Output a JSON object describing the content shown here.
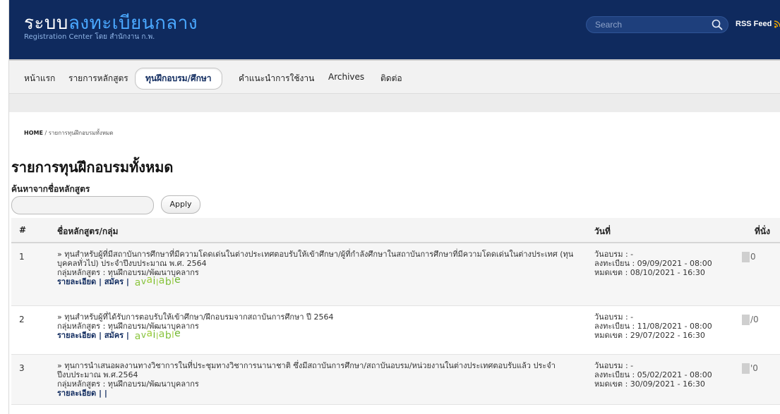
{
  "header": {
    "logo_prefix": "ระบบ",
    "logo_highlight": "ลงทะเบียนกลาง",
    "logo_sub": "Registration Center โดย สำนักงาน ก.พ.",
    "search_placeholder": "Search",
    "rss_label": "RSS Feed",
    "colors": {
      "header_bg": "#0f2a5e",
      "logo_highlight": "#4aa8ff",
      "rss_icon": "#f0a800"
    }
  },
  "nav": {
    "items": [
      {
        "label": "หน้าแรก"
      },
      {
        "label": "รายการหลักสูตร"
      },
      {
        "label": "ทุนฝึกอบรม/ศึกษา",
        "active": true
      },
      {
        "label": "คำแนะนำการใช้งาน"
      },
      {
        "label": "Archives"
      },
      {
        "label": "ติดต่อ"
      }
    ]
  },
  "breadcrumb": {
    "home": "HOME",
    "separator": "/",
    "current": "รายการทุนฝึกอบรมทั้งหมด"
  },
  "page_title": "รายการทุนฝึกอบรมทั้งหมด",
  "filter": {
    "label": "ค้นหาจากชื่อหลักสูตร",
    "input_value": "",
    "apply_label": "Apply"
  },
  "table": {
    "headers": {
      "num": "#",
      "name": "ชื่อหลักสูตร/กลุ่ม",
      "date": "วันที่",
      "seat": "ที่นั่ง"
    },
    "rows": [
      {
        "num": "1",
        "title": "» ทุนสำหรับผู้ที่มีสถาบันการศึกษาที่มีความโดดเด่นในต่างประเทศตอบรับให้เข้าศึกษา/ผู้ที่กำลังศึกษาในสถาบันการศึกษาที่มีความโดดเด่นในต่างประเทศ (ทุนบุคคลทั่วไป) ประจำปีงบประมาณ พ.ศ. 2564",
        "group": "กลุ่มหลักสูตร : ทุนฝึกอบรม/พัฒนาบุคลากร",
        "detail_link": "รายละเอียด",
        "apply_link": "สมัคร",
        "status": "available",
        "train_date": "วันอบรม : -",
        "register_date": "ลงทะเบียน : 09/09/2021 - 08:00",
        "deadline": "หมดเขต : 08/10/2021 - 16:30",
        "seat": "0"
      },
      {
        "num": "2",
        "title": "» ทุนสำหรับผู้ที่ได้รับการตอบรับให้เข้าศึกษา/ฝึกอบรมจากสถาบันการศึกษา ปี 2564",
        "group": "กลุ่มหลักสูตร : ทุนฝึกอบรม/พัฒนาบุคลากร",
        "detail_link": "รายละเอียด",
        "apply_link": "สมัคร",
        "status": "available",
        "train_date": "วันอบรม : -",
        "register_date": "ลงทะเบียน : 11/08/2021 - 08:00",
        "deadline": "หมดเขต : 29/07/2022 - 16:30",
        "seat": "/0"
      },
      {
        "num": "3",
        "title": "» ทุนการนำเสนอผลงานทางวิชาการในที่ประชุมทางวิชาการนานาชาติ ซึ่งมีสถาบันการศึกษา/สถาบันอบรม/หน่วยงานในต่างประเทศตอบรับแล้ว ประจำปีงบประมาณ พ.ศ.2564",
        "group": "กลุ่มหลักสูตร : ทุนฝึกอบรม/พัฒนาบุคลากร",
        "detail_link": "รายละเอียด",
        "tail": " | |",
        "train_date": "วันอบรม : -",
        "register_date": "ลงทะเบียน : 05/02/2021 - 08:00",
        "deadline": "หมดเขต : 30/09/2021 - 16:30",
        "seat": "'0"
      }
    ]
  }
}
